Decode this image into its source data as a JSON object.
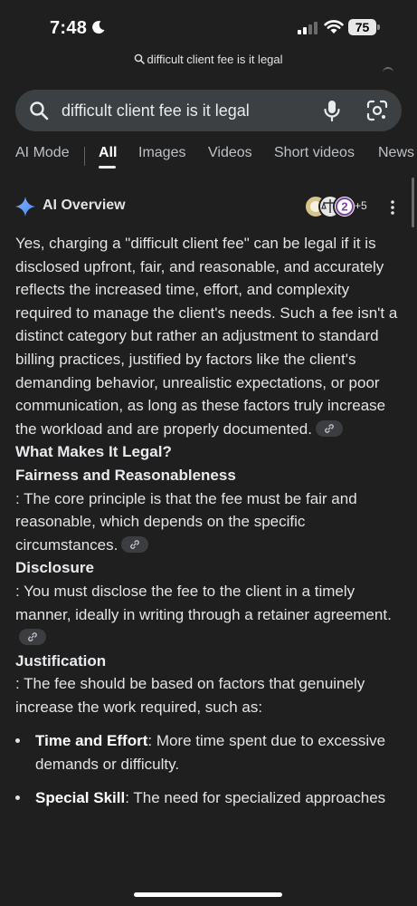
{
  "status_bar": {
    "time": "7:48",
    "battery": "75"
  },
  "url_bar": {
    "text": "difficult client fee is it legal"
  },
  "search": {
    "query": "difficult client fee is it legal"
  },
  "tabs": [
    {
      "label": "AI Mode"
    },
    {
      "label": "All"
    },
    {
      "label": "Images"
    },
    {
      "label": "Videos"
    },
    {
      "label": "Short videos"
    },
    {
      "label": "News"
    }
  ],
  "active_tab": "All",
  "ai_overview": {
    "title": "AI Overview",
    "sources_more": "+5",
    "intro": "Yes, charging a \"difficult client fee\" can be legal if it is disclosed upfront, fair, and reasonable, and accurately reflects the increased time, effort, and complexity required to manage the client's needs. Such a fee isn't a distinct category but rather an adjustment to standard billing practices, justified by factors like the client's demanding behavior, unrealistic expectations, or poor communication, as long as these factors truly increase the workload and are properly documented.",
    "section_heading": "What Makes It Legal?",
    "items": [
      {
        "heading": "Fairness and Reasonableness",
        "text": ": The core principle is that the fee must be fair and reasonable, which depends on the specific circumstances."
      },
      {
        "heading": "Disclosure",
        "text": ": You must disclose the fee to the client in a timely manner, ideally in writing through a retainer agreement."
      },
      {
        "heading": "Justification",
        "text": ": The fee should be based on factors that genuinely increase the work required, such as:"
      }
    ],
    "bullets": [
      {
        "term": "Time and Effort",
        "text": ": More time spent due to excessive demands or difficulty."
      },
      {
        "term": "Special Skill",
        "text": ": The need for specialized approaches"
      }
    ]
  },
  "colors": {
    "background": "#1f1f1f",
    "search_box": "#3c4043",
    "text": "#e3e3e3",
    "accent": "#8ab4f8"
  }
}
